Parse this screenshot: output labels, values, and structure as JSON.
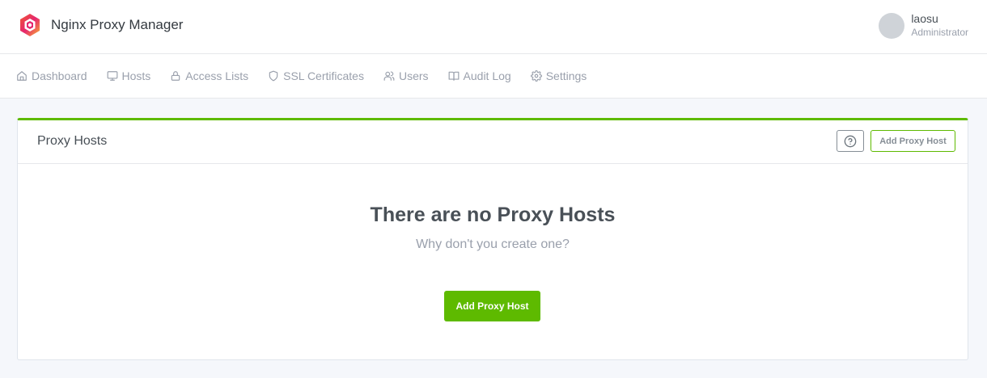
{
  "header": {
    "app_name": "Nginx Proxy Manager",
    "logo_icon": "nginx-proxy-manager-logo",
    "user": {
      "name": "laosu",
      "role": "Administrator"
    }
  },
  "nav": {
    "items": [
      {
        "label": "Dashboard",
        "icon": "home-icon"
      },
      {
        "label": "Hosts",
        "icon": "monitor-icon"
      },
      {
        "label": "Access Lists",
        "icon": "lock-icon"
      },
      {
        "label": "SSL Certificates",
        "icon": "shield-icon"
      },
      {
        "label": "Users",
        "icon": "users-icon"
      },
      {
        "label": "Audit Log",
        "icon": "book-icon"
      },
      {
        "label": "Settings",
        "icon": "gear-icon"
      }
    ]
  },
  "card": {
    "title": "Proxy Hosts",
    "help_icon": "help-circle-icon",
    "add_label": "Add Proxy Host",
    "empty_title": "There are no Proxy Hosts",
    "empty_subtitle": "Why don't you create one?",
    "empty_add_label": "Add Proxy Host"
  },
  "colors": {
    "accent": "#5eba00",
    "page_background": "#f5f7fb",
    "muted_text": "#9aa0ac"
  }
}
